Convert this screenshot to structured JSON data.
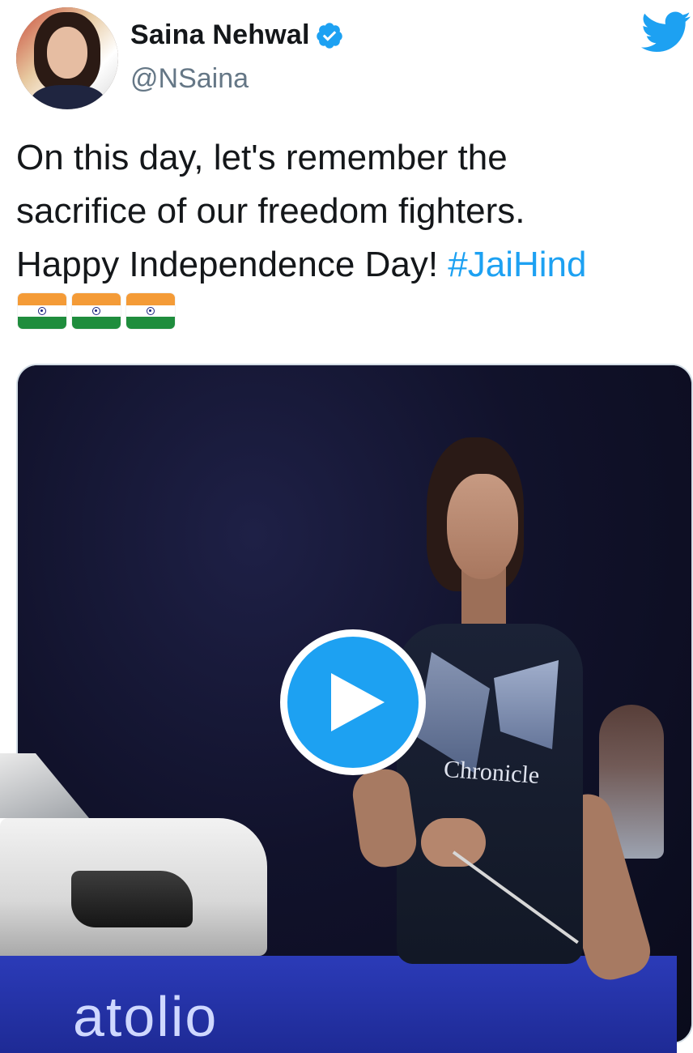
{
  "author": {
    "name": "Saina Nehwal",
    "handle": "@NSaina",
    "verified": true,
    "avatar_icon": "profile-photo"
  },
  "header": {
    "brand_icon": "twitter-bird-icon",
    "brand_color": "#1da1f2"
  },
  "tweet": {
    "line1": "On this day, let's remember the",
    "line2": "sacrifice of our freedom fighters.",
    "line3_text": "Happy Independence Day! ",
    "hashtag": "#JaiHind",
    "emoji": [
      "india-flag-icon",
      "india-flag-icon",
      "india-flag-icon"
    ]
  },
  "media": {
    "type": "video",
    "play_icon": "play-icon",
    "jersey_text": "Chronicle",
    "banner_text": "atolio"
  },
  "colors": {
    "text": "#14171a",
    "secondary": "#657786",
    "link": "#1da1f2",
    "verified": "#1da1f2"
  }
}
